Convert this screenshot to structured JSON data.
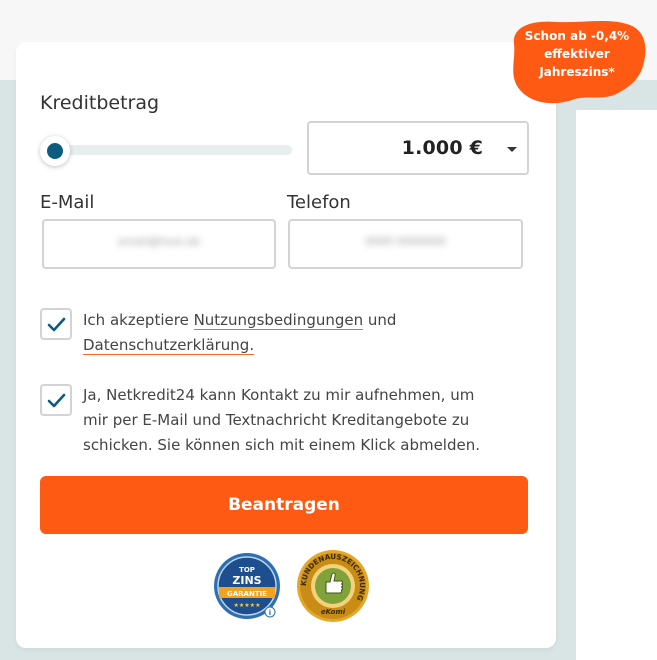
{
  "badge": {
    "line1": "Schon ab -0,4%",
    "line2": "effektiver",
    "line3": "Jahreszins*",
    "color": "#ff5a14"
  },
  "loan": {
    "label": "Kreditbetrag",
    "amount": "1.000 €",
    "slider_fraction": 0.0
  },
  "email": {
    "label": "E-Mail",
    "value": "email@host.de"
  },
  "phone": {
    "label": "Telefon",
    "value": "0000 0000000"
  },
  "consent1": {
    "checked": true,
    "text_before": "Ich akzeptiere ",
    "link1": "Nutzungsbedingungen",
    "text_middle": " und",
    "link2": "Datenschutzerklärung."
  },
  "consent2": {
    "checked": true,
    "text": "Ja, Netkredit24 kann Kontakt zu mir aufnehmen, um mir per E-Mail und Textnachricht Kreditangebote zu schicken. Sie können sich mit einem Klick abmelden."
  },
  "submit": {
    "label": "Beantragen"
  },
  "seals": {
    "topzins_line1": "TOP",
    "topzins_line2": "ZINS",
    "topzins_line3": "GARANTIE",
    "ekomi_ring": "KUNDENAUSZEICHNUNG",
    "ekomi_brand": "eKomi"
  },
  "colors": {
    "accent": "#ff5a14",
    "slider_thumb": "#0b5c7e",
    "checkmark": "#0b5c7e"
  }
}
